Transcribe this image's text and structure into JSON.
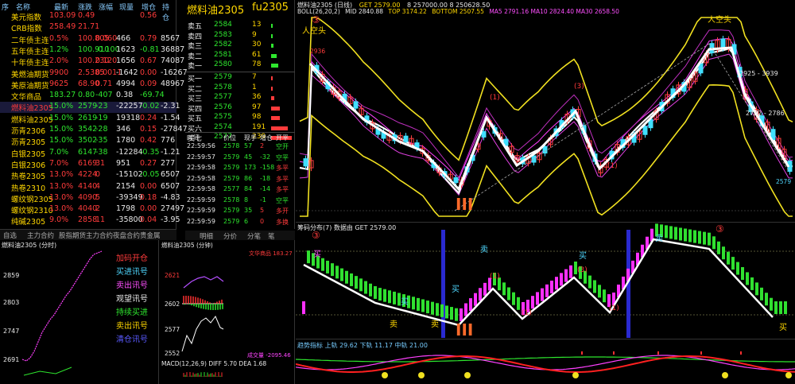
{
  "quote_list": {
    "headers": [
      "序",
      "名称",
      "最新",
      "涨跌",
      "涨幅",
      "现量",
      "增仓",
      "持仓"
    ],
    "rows": [
      {
        "n": "",
        "name": "美元指数",
        "last": "103.09",
        "chg": "0.49",
        "pct": "",
        "vol": "",
        "inc": "0.56",
        "oi": ""
      },
      {
        "n": "",
        "name": "CRB指数",
        "last": "258.49",
        "chg": "21.71",
        "pct": "",
        "vol": "",
        "inc": "",
        "oi": ""
      },
      {
        "n": "",
        "name": "二年债主连",
        "last": "0.5%",
        "chg": "100.805",
        "pct": "0.060",
        "vol": "466",
        "inc": "0.79",
        "oi": "8567"
      },
      {
        "n": "",
        "name": "五年债主连",
        "last": "1.2%",
        "chg": "100.910",
        "pct": "-0.100",
        "vol": "1623",
        "inc": "-0.81",
        "oi": "36887"
      },
      {
        "n": "",
        "name": "十年债主连",
        "last": "2.0%",
        "chg": "100.230",
        "pct": "0.120",
        "vol": "1656",
        "inc": "0.67",
        "oi": "74087"
      },
      {
        "n": "",
        "name": "美燃油期货",
        "last": "9900",
        "chg": "2.5385",
        "pct": "0.0011",
        "vol": "-1642",
        "inc": "0.00",
        "oi": "-16267"
      },
      {
        "n": "",
        "name": "美原油期货",
        "last": "9625",
        "chg": "68.90",
        "pct": "0.71",
        "vol": "4994",
        "inc": "0.09",
        "oi": "48967"
      },
      {
        "n": "",
        "name": "文华商品",
        "last": "183.27",
        "chg": "0.80",
        "pct": "-407",
        "vol": "0.38",
        "inc": "-69.74",
        "oi": ""
      },
      {
        "n": "",
        "name": "燃料油2305",
        "last": "15.0%",
        "chg": "2579",
        "pct": "-23",
        "vol": "-22257",
        "inc": "-0.02",
        "oi": "-2.31"
      },
      {
        "n": "",
        "name": "燃料油2305",
        "last": "15.0%",
        "chg": "2619",
        "pct": "-19",
        "vol": "19318",
        "inc": "0.24",
        "oi": "-1.54"
      },
      {
        "n": "",
        "name": "沥青2306",
        "last": "15.0%",
        "chg": "3542",
        "pct": "-28",
        "vol": "346",
        "inc": "0.15",
        "oi": "-27847"
      },
      {
        "n": "",
        "name": "沥青2305",
        "last": "15.0%",
        "chg": "3502",
        "pct": "-35",
        "vol": "1780",
        "inc": "0.42",
        "oi": "776"
      },
      {
        "n": "",
        "name": "白银2305",
        "last": "7.0%",
        "chg": "6147",
        "pct": "-38",
        "vol": "-12284",
        "inc": "-0.35",
        "oi": "-1.21"
      },
      {
        "n": "",
        "name": "白银2306",
        "last": "7.0%",
        "chg": "6169",
        "pct": "31",
        "vol": "951",
        "inc": "0.27",
        "oi": "277"
      },
      {
        "n": "",
        "name": "热卷2305",
        "last": "13.0%",
        "chg": "4224",
        "pct": "0",
        "vol": "-15102",
        "inc": "-0.05",
        "oi": "6507"
      },
      {
        "n": "",
        "name": "热卷2310",
        "last": "13.0%",
        "chg": "4140",
        "pct": "4",
        "vol": "2154",
        "inc": "0.00",
        "oi": "6507"
      },
      {
        "n": "",
        "name": "螺纹钢2305",
        "last": "13.0%",
        "chg": "4090",
        "pct": "5",
        "vol": "-39349",
        "inc": "0.18",
        "oi": "-4.83"
      },
      {
        "n": "",
        "name": "螺纹钢2310",
        "last": "13.0%",
        "chg": "4040",
        "pct": "2",
        "vol": "1798",
        "inc": "0.00",
        "oi": "27497"
      },
      {
        "n": "",
        "name": "纯碱2305",
        "last": "9.0%",
        "chg": "2858",
        "pct": "11",
        "vol": "-35800",
        "inc": "0.04",
        "oi": "-3.95"
      }
    ]
  },
  "tabs": [
    "自选",
    "主力合约",
    "股指期货",
    "主力合约",
    "夜盘合约",
    "贵金属"
  ],
  "order_book": {
    "title": "燃料油2305",
    "code": "fu2305",
    "asks": [
      {
        "label": "卖五",
        "price": "2584",
        "vol": "13"
      },
      {
        "label": "卖四",
        "price": "2583",
        "vol": "9"
      },
      {
        "label": "卖三",
        "price": "2582",
        "vol": "30"
      },
      {
        "label": "卖二",
        "price": "2581",
        "vol": "61"
      },
      {
        "label": "卖一",
        "price": "2580",
        "vol": "78"
      }
    ],
    "bids": [
      {
        "label": "买一",
        "price": "2579",
        "vol": "7"
      },
      {
        "label": "买二",
        "price": "2578",
        "vol": "1"
      },
      {
        "label": "买三",
        "price": "2577",
        "vol": "36"
      },
      {
        "label": "买四",
        "price": "2576",
        "vol": "97"
      },
      {
        "label": "买五",
        "price": "2575",
        "vol": "98"
      },
      {
        "label": "买六",
        "price": "2574",
        "vol": "191"
      },
      {
        "label": "买七",
        "price": "2577",
        "vol": "239"
      }
    ],
    "tick_headers": [
      "时间",
      "价位",
      "现手",
      "增仓",
      "开平"
    ],
    "ticks": [
      {
        "t": "22:59:56",
        "p": "2578",
        "v": "57",
        "i": "2",
        "o": "空开"
      },
      {
        "t": "22:59:57",
        "p": "2579",
        "v": "45",
        "i": "-32",
        "o": "空平"
      },
      {
        "t": "22:59:58",
        "p": "2579",
        "v": "173",
        "i": "-158",
        "o": "多平"
      },
      {
        "t": "22:59:58",
        "p": "2579",
        "v": "86",
        "i": "-18",
        "o": "多平"
      },
      {
        "t": "22:59:58",
        "p": "2577",
        "v": "84",
        "i": "-14",
        "o": "多平"
      },
      {
        "t": "22:59:59",
        "p": "2578",
        "v": "8",
        "i": "-1",
        "o": "空平"
      },
      {
        "t": "22:59:59",
        "p": "2579",
        "v": "35",
        "i": "5",
        "o": "多开"
      },
      {
        "t": "22:59:59",
        "p": "2579",
        "v": "6",
        "i": "0",
        "o": "多换"
      }
    ],
    "footer_tabs": [
      "明细",
      "分价",
      "分笔",
      "笔"
    ]
  },
  "main_chart": {
    "header": "燃料油2305 (日线)",
    "boll": "BOLL(26,20,2)",
    "mid": "MID 2840.88",
    "top": "TOP 3174.22",
    "bottom": "BOTTOM 2507.55",
    "extra": "MA5 2791.16  MA10 2824.40  MA30 2658.50",
    "get": "GET 2579.00",
    "right_vals": "8 257000.00   8 250628.50",
    "left_label": "人空头",
    "right_label": "人空头",
    "levels": [
      "2936",
      "2579"
    ],
    "annotations": [
      "(1)",
      "(3)",
      "(1)",
      "III"
    ],
    "price_labels": [
      "2925 - 3939",
      "2782 - 2786"
    ]
  },
  "signal_chart": {
    "header": "筹码分布(7)  数据由 GET 2579.00",
    "labels": [
      "买",
      "卖",
      "买",
      "卖",
      "买",
      "卖",
      "买",
      "卖",
      "买"
    ],
    "annotations": [
      "(1)",
      "(3)",
      "(1)",
      "(1)",
      "III"
    ]
  },
  "oscillator": {
    "header": "趋势指标  上轨 29.62  下轨 11.17  中轨 21.00"
  },
  "intraday": {
    "title": "燃料油2305 (分时)",
    "y_labels": [
      "2859",
      "2803",
      "2747",
      "2691"
    ],
    "signals": [
      "加码开仓",
      "买进讯号",
      "卖出讯号",
      "观望讯号",
      "持续买进",
      "卖出讯号",
      "清仓讯号"
    ]
  },
  "mini_chart": {
    "title": "燃料油2305 (分钟)",
    "right_label": "文华商品 183.27",
    "y_labels": [
      "2621",
      "2602",
      "2577",
      "2552"
    ],
    "macd": "MACD(12,26,9)  DIFF 5.70  DEA 1.68",
    "extra": "成交量 -2095.46"
  }
}
